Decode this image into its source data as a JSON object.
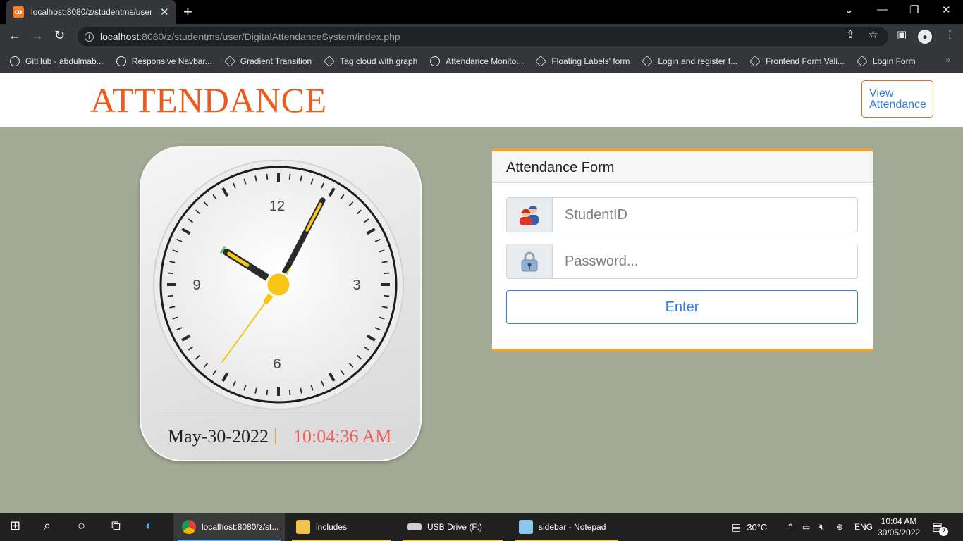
{
  "browser": {
    "tab_title": "localhost:8080/z/studentms/user",
    "url_host": "localhost",
    "url_rest": ":8080/z/studentms/user/DigitalAttendanceSystem/index.php",
    "bookmarks": [
      "GitHub - abdulmab...",
      "Responsive Navbar...",
      "Gradient Transition",
      "Tag cloud with graph",
      "Attendance Monito...",
      "Floating Labels' form",
      "Login and register f...",
      "Frontend Form Vali...",
      "Login Form"
    ]
  },
  "header": {
    "brand": "ATTENDANCE",
    "view_attendance": "View Attendance"
  },
  "clock": {
    "numerals": [
      "12",
      "3",
      "6",
      "9"
    ],
    "date": "May-30-2022",
    "time": "10:04:36 AM",
    "hands": {
      "hour": 10,
      "minute": 4,
      "second": 36
    }
  },
  "form": {
    "title": "Attendance Form",
    "student_id_placeholder": "StudentID",
    "password_placeholder": "Password...",
    "enter_label": "Enter"
  },
  "taskbar": {
    "apps": [
      "localhost:8080/z/st...",
      "includes",
      "USB Drive (F:)",
      "sidebar - Notepad"
    ],
    "temperature": "30°C",
    "language": "ENG",
    "time": "10:04 AM",
    "date": "30/05/2022",
    "notifications": "2"
  },
  "colors": {
    "accent": "#f05a1c",
    "form_border": "#f5a21f",
    "link_blue": "#2f7de1",
    "background": "#a3aa95"
  }
}
